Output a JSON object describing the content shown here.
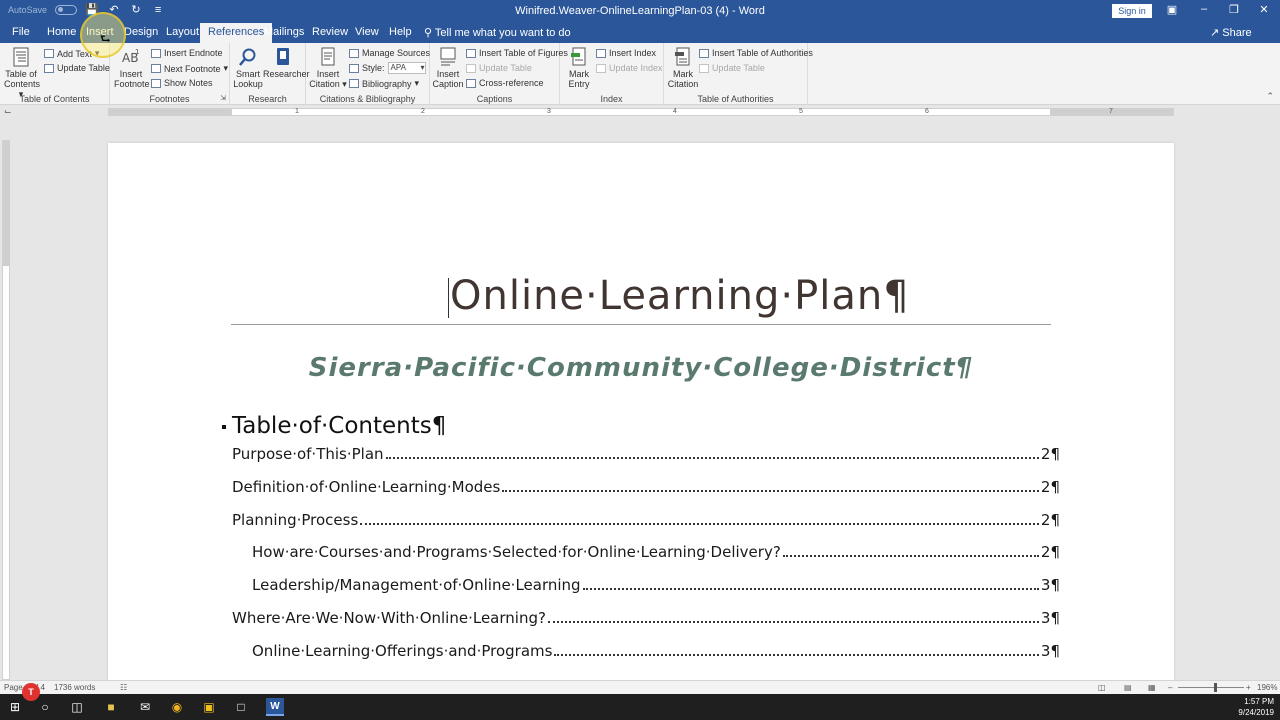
{
  "titlebar": {
    "autosave_label": "AutoSave",
    "autosave_state": "Off",
    "document_title": "Winifred.Weaver-OnlineLearningPlan-03 (4)  -  Word",
    "signin_label": "Sign in"
  },
  "tabs": [
    {
      "label": "File"
    },
    {
      "label": "Home"
    },
    {
      "label": "Insert"
    },
    {
      "label": "Design"
    },
    {
      "label": "Layout"
    },
    {
      "label": "References"
    },
    {
      "label": "Mailings"
    },
    {
      "label": "Review"
    },
    {
      "label": "View"
    },
    {
      "label": "Help"
    }
  ],
  "tellme": "Tell me what you want to do",
  "share_label": "Share",
  "ribbon": {
    "toc_group": {
      "label": "Table of Contents",
      "toc_btn_line1": "Table of",
      "toc_btn_line2": "Contents",
      "add_text": "Add Text",
      "update_table": "Update Table"
    },
    "footnotes_group": {
      "label": "Footnotes",
      "insert_footnote_line1": "Insert",
      "insert_footnote_line2": "Footnote",
      "insert_endnote": "Insert Endnote",
      "next_footnote": "Next Footnote",
      "show_notes": "Show Notes"
    },
    "research_group": {
      "label": "Research",
      "smart_lookup_line1": "Smart",
      "smart_lookup_line2": "Lookup",
      "researcher": "Researcher"
    },
    "citations_group": {
      "label": "Citations & Bibliography",
      "insert_citation_line1": "Insert",
      "insert_citation_line2": "Citation",
      "manage_sources": "Manage Sources",
      "style_label": "Style:",
      "style_value": "APA",
      "bibliography": "Bibliography"
    },
    "captions_group": {
      "label": "Captions",
      "insert_caption_line1": "Insert",
      "insert_caption_line2": "Caption",
      "insert_table_of_figures": "Insert Table of Figures",
      "update_table": "Update Table",
      "cross_reference": "Cross-reference"
    },
    "index_group": {
      "label": "Index",
      "mark_entry_line1": "Mark",
      "mark_entry_line2": "Entry",
      "insert_index": "Insert Index",
      "update_index": "Update Index"
    },
    "authorities_group": {
      "label": "Table of Authorities",
      "mark_citation_line1": "Mark",
      "mark_citation_line2": "Citation",
      "insert_table_of_authorities": "Insert Table of Authorities",
      "update_table": "Update Table"
    }
  },
  "ruler_numbers": [
    "1",
    "2",
    "3",
    "4",
    "5",
    "6",
    "7"
  ],
  "document": {
    "title": "Online·Learning·Plan¶",
    "subtitle": "Sierra·Pacific·Community·College·District¶",
    "toc_heading": "Table·of·Contents¶",
    "toc_entries": [
      {
        "text": "Purpose·of·This·Plan",
        "page": "2¶",
        "level": 1
      },
      {
        "text": "Definition·of·Online·Learning·Modes",
        "page": "2¶",
        "level": 1
      },
      {
        "text": "Planning·Process",
        "page": "2¶",
        "level": 1
      },
      {
        "text": "How·are·Courses·and·Programs·Selected·for·Online·Learning·Delivery?",
        "page": "2¶",
        "level": 2
      },
      {
        "text": "Leadership/Management·of·Online·Learning",
        "page": "3¶",
        "level": 2
      },
      {
        "text": "Where·Are·We·Now·With·Online·Learning?",
        "page": "3¶",
        "level": 1
      },
      {
        "text": "Online·Learning·Offerings·and·Programs",
        "page": "3¶",
        "level": 2
      }
    ]
  },
  "statusbar": {
    "page": "Page 1 of 4",
    "words": "1736 words",
    "zoom": "196%"
  },
  "taskbar": {
    "word_label": "W",
    "time": "1:57 PM",
    "date": "9/24/2019"
  },
  "recording_badge": "T",
  "colors": {
    "word_blue": "#2b579a",
    "subtitle_green": "#5b7a6e"
  }
}
